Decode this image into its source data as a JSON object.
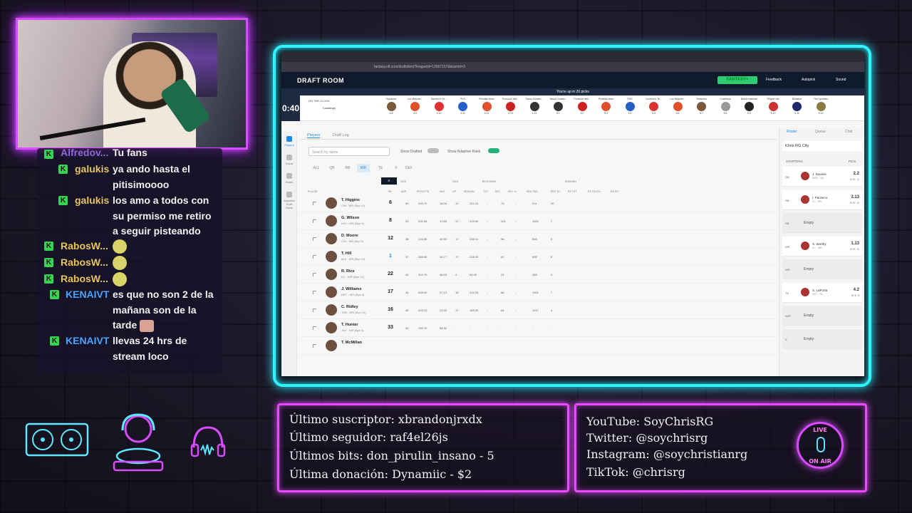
{
  "chat": {
    "messages": [
      {
        "badge": "K",
        "user": "Alfredov...",
        "text": "Tu fans",
        "user_color": "#8a6bd6"
      },
      {
        "badge": "K",
        "user": "galukis",
        "text": "ya ando hasta el pitisimoooo",
        "user_color": "#e8c55a"
      },
      {
        "badge": "K",
        "user": "galukis",
        "text": "los amo a todos con su permiso me retiro a seguir pisteando",
        "user_color": "#e8c55a"
      },
      {
        "badge": "K",
        "user": "RabosW...",
        "text": "",
        "user_color": "#e8c55a"
      },
      {
        "badge": "K",
        "user": "RabosW...",
        "text": "",
        "user_color": "#e8c55a"
      },
      {
        "badge": "K",
        "user": "RabosW...",
        "text": "",
        "user_color": "#e8c55a"
      },
      {
        "badge": "K",
        "user": "KENAIVT",
        "text": "es que no son 2 de la mañana son de la tarde",
        "user_color": "#4aa3ff"
      },
      {
        "badge": "K",
        "user": "KENAIVT",
        "text": "llevas 24 hrs de stream loco",
        "user_color": "#4aa3ff"
      }
    ]
  },
  "browser": {
    "url": "fantasy.nfl.com/draftclient?leagueId=12667157&teamId=3"
  },
  "draft": {
    "app_title": "DRAFT ROOM",
    "fantasy_label": "FANTASY+",
    "feedback": "Feedback",
    "autopick": "Autopick",
    "sound": "Sound",
    "banner": "You're up in 20 picks",
    "clock_label": "R4 PICK 7",
    "clock": "0:40",
    "on_the_clock": "ON THE CLOCK",
    "on_the_clock_team": "Cockboys",
    "ticker_picks": [
      {
        "team": "Tiradores",
        "num": "4.8",
        "color": "#7a5a3a"
      },
      {
        "team": "Los Mascari...",
        "num": "4.9",
        "color": "#e0502a"
      },
      {
        "team": "Gomero's Te...",
        "num": "4.10",
        "color": "#d33"
      },
      {
        "team": "PKS",
        "num": "4.11",
        "color": "#245fc8"
      },
      {
        "team": "Pichillas team",
        "num": "4.12",
        "color": "#e0502a"
      },
      {
        "team": "Ponsoon dell...",
        "num": "4.13",
        "color": "#c22"
      },
      {
        "team": "Tasos Dorado...",
        "num": "4.14",
        "color": "#333"
      },
      {
        "team": "Tasos Dorado...",
        "num": "5.1",
        "color": "#333"
      },
      {
        "team": "Ponsoon dell...",
        "num": "5.2",
        "color": "#c22"
      },
      {
        "team": "Pichillas team",
        "num": "5.3",
        "color": "#e0502a"
      },
      {
        "team": "PKS",
        "num": "5.4",
        "color": "#245fc8"
      },
      {
        "team": "Gomero's Te...",
        "num": "5.5",
        "color": "#d33"
      },
      {
        "team": "Los Mascari...",
        "num": "5.6",
        "color": "#e0502a"
      },
      {
        "team": "Tiradores",
        "num": "5.7",
        "color": "#7a5a3a"
      },
      {
        "team": "Cockboys",
        "num": "5.8",
        "color": "#999"
      },
      {
        "team": "Black mambas",
        "num": "5.9",
        "color": "#222"
      },
      {
        "team": "Pepper Ale",
        "num": "5.10",
        "color": "#c33"
      },
      {
        "team": "Bellakos",
        "num": "5.11",
        "color": "#1e2a6a"
      },
      {
        "team": "The Apostles",
        "num": "5.12",
        "color": "#8a7a44"
      }
    ],
    "tabs": [
      "Players",
      "Draft Log"
    ],
    "left_nav": [
      "Players",
      "Event",
      "Rules",
      "Adaptive Draft Rank"
    ],
    "search_placeholder": "Search by name",
    "show_drafted": "Show Drafted",
    "show_adaptive": "Show Adaptive Rank",
    "positions": [
      "ALL",
      "QB",
      "RB",
      "WR",
      "TE",
      "K",
      "DEF"
    ],
    "active_position": "WR",
    "year_selected": "R",
    "year_2025": "2025",
    "year_2024": "2024",
    "receiving": "RECEIVING",
    "rushing": "RUSHING",
    "col_player": "PLAYER",
    "columns": [
      "RK",
      "ADP",
      "PROJ PTS",
      "AVG",
      "GP",
      "SEASON",
      "TGT",
      "REC",
      "REC %",
      "REC YDS",
      "REC TD",
      "RZ TGT",
      "RZ TOUCH",
      "RZ ATT"
    ],
    "players": [
      {
        "name": "T. Higgins",
        "team": "CIN - WR (Bye 10)",
        "rank": "6",
        "blue": false,
        "stats": [
          "50",
          "233.70",
          "15.04",
          "12",
          "222.10",
          "-",
          "73",
          "-",
          "911",
          "10"
        ]
      },
      {
        "name": "G. Wilson",
        "team": "NYJ - WR (Bye 9)",
        "rank": "8",
        "blue": false,
        "stats": [
          "33",
          "231.00",
          "17.60",
          "17",
          "213.90",
          "-",
          "101",
          "-",
          "1104",
          "7"
        ]
      },
      {
        "name": "D. Moore",
        "team": "CHI - WR (Bye 5)",
        "rank": "12",
        "blue": false,
        "stats": [
          "38",
          "216.50",
          "49.90",
          "17",
          "238.10",
          "-",
          "98",
          "-",
          "966",
          "5"
        ]
      },
      {
        "name": "T. Hill",
        "team": "MIA - WR (Bye 12)",
        "rank": "1",
        "blue": true,
        "stats": [
          "37",
          "268.90",
          "16.77",
          "17",
          "218.20",
          "-",
          "81",
          "-",
          "995",
          "6"
        ]
      },
      {
        "name": "R. Rice",
        "team": "KC - WR (Bye 10)",
        "rank": "22",
        "blue": false,
        "stats": [
          "42",
          "204.70",
          "46.53",
          "4",
          "64.00",
          "-",
          "24",
          "-",
          "288",
          "2"
        ]
      },
      {
        "name": "J. Williams",
        "team": "DET - WR (Bye 8)",
        "rank": "17",
        "blue": false,
        "stats": [
          "44",
          "208.00",
          "37.12",
          "15",
          "212.20",
          "-",
          "58",
          "-",
          "1001",
          "7"
        ]
      },
      {
        "name": "C. Ridley",
        "team": "TEN - WR (Bye 10)",
        "rank": "16",
        "blue": false,
        "stats": [
          "40",
          "203.10",
          "13.90",
          "17",
          "195.20",
          "-",
          "64",
          "-",
          "1017",
          "4"
        ]
      },
      {
        "name": "T. Hunter",
        "team": "JAX - WR (Bye 8)",
        "rank": "33",
        "blue": false,
        "stats": [
          "50",
          "195.70",
          "65.30",
          "-",
          "-",
          "-",
          "-",
          "-",
          "-",
          "-"
        ]
      },
      {
        "name": "T. McMillan",
        "team": "",
        "rank": "",
        "blue": false,
        "stats": []
      }
    ],
    "sidebar_tabs": [
      "Roster",
      "Queue",
      "Chat"
    ],
    "team_select": "Khris RG City",
    "starters": "STARTERS",
    "pick_label": "PICK",
    "roster": [
      {
        "pos": "QB",
        "name": "J. Daniels",
        "sub": "WAS - QB",
        "pick": "2.2",
        "bye": "BYE: 12",
        "empty": false
      },
      {
        "pos": "RB",
        "name": "I. Pacheco",
        "sub": "KC - RB",
        "pick": "3.13",
        "bye": "BYE: 10",
        "empty": false
      },
      {
        "pos": "RB",
        "name": "Empty",
        "empty": true
      },
      {
        "pos": "WR",
        "name": "X. Worthy",
        "sub": "KC - WR",
        "pick": "1.13",
        "bye": "BYE: 10",
        "empty": false
      },
      {
        "pos": "WR",
        "name": "Empty",
        "empty": true
      },
      {
        "pos": "TE",
        "name": "S. LaPorta",
        "sub": "DET - TE",
        "pick": "4.2",
        "bye": "BYE: 8",
        "empty": false
      },
      {
        "pos": "W/R",
        "name": "Empty",
        "empty": true
      },
      {
        "pos": "K",
        "name": "Empty",
        "empty": true
      }
    ]
  },
  "stats_panel": {
    "subscriber": "Último suscriptor: xbrandonjrxdx",
    "follower": "Último seguidor: raf4el26js",
    "bits": "Últimos bits: don_pirulin_insano - 5",
    "donation": "Última donación: Dynamiic - $2"
  },
  "socials_panel": {
    "youtube": "YouTube: SoyChrisRG",
    "twitter": "Twitter: @soychrisrg",
    "instagram": "Instagram: @soychristianrg",
    "tiktok": "TikTok: @chrisrg"
  },
  "onair": {
    "top": "LIVE",
    "bottom": "ON AIR"
  },
  "colors": {
    "neon_cyan": "#2ff3ff",
    "neon_pink": "#e84bff",
    "accent_green": "#2ecc71",
    "accent_blue": "#1e88e5"
  }
}
